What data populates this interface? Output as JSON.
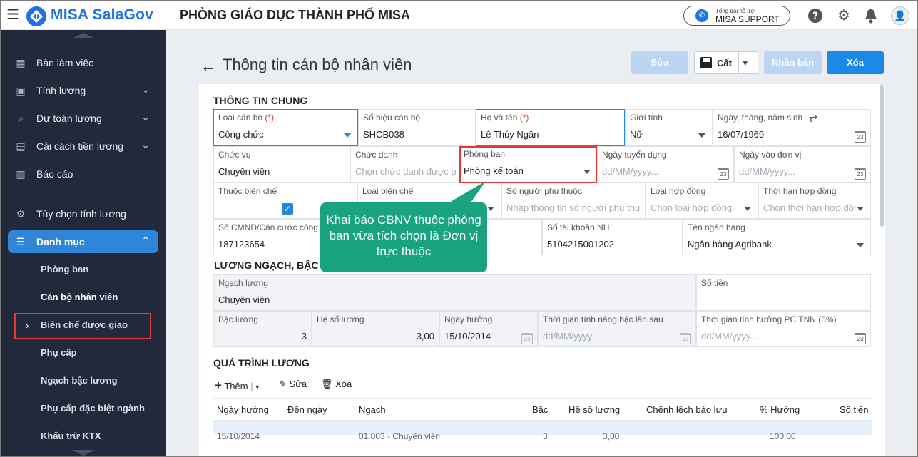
{
  "header": {
    "brand": "MISA SalaGov",
    "org": "PHÒNG GIÁO DỤC THÀNH PHỐ MISA",
    "support_line1": "Tổng đài hỗ trợ",
    "support_line2": "MISA SUPPORT"
  },
  "sidebar": {
    "items": [
      {
        "label": "Bàn làm việc",
        "icon": "dashboard-icon"
      },
      {
        "label": "Tính lương",
        "icon": "wallet-icon"
      },
      {
        "label": "Dự toán lương",
        "icon": "search-icon"
      },
      {
        "label": "Cải cách tiền lương",
        "icon": "refresh-icon"
      },
      {
        "label": "Báo cáo",
        "icon": "chart-icon"
      },
      {
        "label": "Tùy chọn tính lương",
        "icon": "settings-icon"
      },
      {
        "label": "Danh mục",
        "icon": "list-icon"
      }
    ],
    "sub": [
      "Phòng ban",
      "Cán bộ nhân viên",
      "Biên chế được giao",
      "Phụ cấp",
      "Ngạch bậc lương",
      "Phụ cấp đặc biệt ngành",
      "Khấu trừ KTX"
    ]
  },
  "page": {
    "title": "Thông tin cán bộ nhân viên",
    "edit": "Sửa",
    "save": "Cất",
    "duplicate": "Nhân bản",
    "delete": "Xóa"
  },
  "general": {
    "heading": "THÔNG TIN CHUNG",
    "loai_can_bo": {
      "label": "Loại cán bộ",
      "req": "(*)",
      "value": "Công chức"
    },
    "so_hieu": {
      "label": "Số hiệu cán bộ",
      "value": "SHCB038"
    },
    "ho_ten": {
      "label": "Họ và tên",
      "req": "(*)",
      "value": "Lê Thúy Ngân"
    },
    "gioi_tinh": {
      "label": "Giới tính",
      "value": "Nữ"
    },
    "ngay_sinh": {
      "label": "Ngày, tháng, năm sinh",
      "value": "16/07/1969"
    },
    "chuc_vu": {
      "label": "Chức vụ",
      "value": "Chuyên viên"
    },
    "chuc_danh": {
      "label": "Chức danh",
      "placeholder": "Chọn chức danh được pl"
    },
    "phong_ban": {
      "label": "Phòng ban",
      "value": "Phòng kế toán"
    },
    "ngay_tuyen": {
      "label": "Ngày tuyển dụng",
      "placeholder": "dd/MM/yyyy..."
    },
    "ngay_vao": {
      "label": "Ngày vào đơn vị",
      "placeholder": "dd/MM/yyyy..."
    },
    "thuoc_bien_che": {
      "label": "Thuộc biên chế"
    },
    "loai_bien_che": {
      "label": "Loại biên chế"
    },
    "so_nguoi_pt": {
      "label": "Số người phụ thuộc",
      "placeholder": "Nhập thông tin số người phụ thu"
    },
    "loai_hd": {
      "label": "Loại hợp đồng",
      "placeholder": "Chọn loại hợp đồng"
    },
    "thoi_han_hd": {
      "label": "Thời hạn hợp đồng",
      "placeholder": "Chọn thời hạn hợp đồn"
    },
    "cmnd": {
      "label": "Số CMND/Căn cước công c",
      "value": "187123654"
    },
    "tai_khoan": {
      "label": "Số tài khoản NH",
      "value": "5104215001202"
    },
    "ngan_hang": {
      "label": "Tên ngân hàng",
      "value": "Ngân hàng Agribank"
    }
  },
  "callout": "Khai báo CBNV thuộc phòng ban vừa tích chọn là Đơn vị trực thuộc",
  "salary": {
    "heading": "LƯƠNG NGẠCH, BẬC I",
    "ngach": {
      "label": "Ngạch lương",
      "value": "Chuyên viên"
    },
    "so_tien": {
      "label": "Số tiền"
    },
    "bac": {
      "label": "Bậc lương",
      "value": "3"
    },
    "he_so": {
      "label": "Hệ số lương",
      "value": "3,00"
    },
    "ngay_huong": {
      "label": "Ngày hưởng",
      "value": "15/10/2014"
    },
    "nang_bac": {
      "label": "Thời gian tính nâng bậc lần sau",
      "placeholder": "dd/MM/yyyy..."
    },
    "pc_tnn": {
      "label": "Thời gian tính hưởng PC TNN (5%)",
      "placeholder": "dd/MM/yyyy..."
    }
  },
  "history": {
    "heading": "QUÁ TRÌNH LƯƠNG",
    "add": "Thêm",
    "edit": "Sửa",
    "delete": "Xóa",
    "columns": [
      "Ngày hưởng",
      "Đến ngày",
      "Ngạch",
      "Bậc",
      "Hệ số lương",
      "Chênh lệch bảo lưu",
      "% Hưởng",
      "Số tiền"
    ],
    "row_partial": [
      "15/10/2014",
      "01.003 - Chuyên viên",
      "3",
      "3,00",
      "100,00"
    ]
  }
}
